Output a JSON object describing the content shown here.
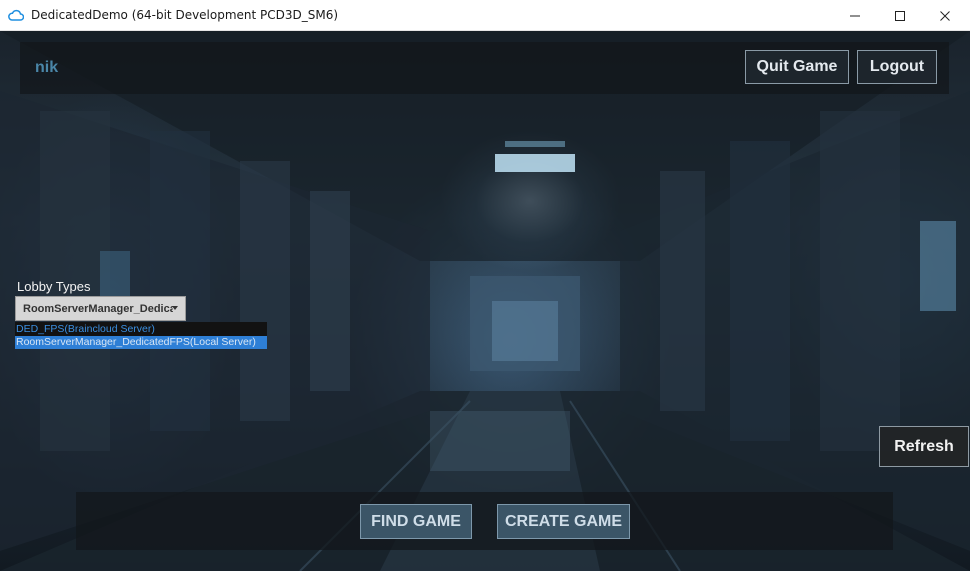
{
  "window": {
    "title": "DedicatedDemo (64-bit Development PCD3D_SM6)",
    "icon": "cloud-icon",
    "controls": [
      "minimize-icon",
      "maximize-icon",
      "close-icon"
    ]
  },
  "header": {
    "username": "nik",
    "quit_label": "Quit Game",
    "logout_label": "Logout"
  },
  "lobby": {
    "label": "Lobby Types",
    "selected": "RoomServerManager_DedicatedFPS(Local Server)",
    "selected_display": "RoomServerManager_Dedicat",
    "options": [
      "DED_FPS(Braincloud Server)",
      "RoomServerManager_DedicatedFPS(Local Server)"
    ]
  },
  "actions": {
    "refresh_label": "Refresh",
    "find_label": "FIND GAME",
    "create_label": "CREATE GAME"
  },
  "colors": {
    "username": "#4a86a8",
    "highlight": "#2e7fd6",
    "option_text": "#3b8fe0",
    "game_button": "#3b5567"
  }
}
